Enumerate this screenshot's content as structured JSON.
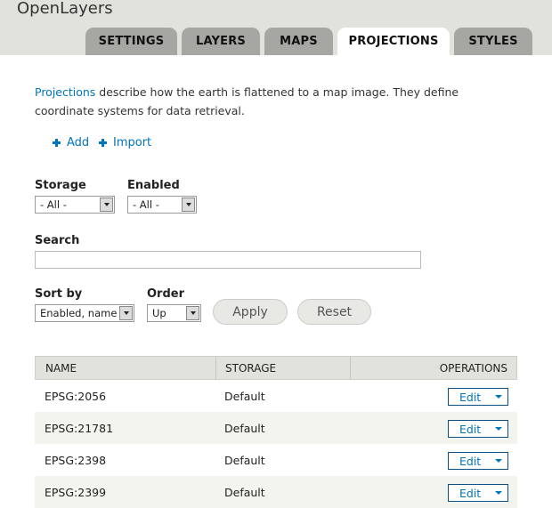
{
  "app": {
    "title": "OpenLayers"
  },
  "tabs": [
    {
      "label": "SETTINGS"
    },
    {
      "label": "LAYERS"
    },
    {
      "label": "MAPS"
    },
    {
      "label": "PROJECTIONS",
      "active": true
    },
    {
      "label": "STYLES"
    }
  ],
  "intro": {
    "link": "Projections",
    "text": " describe how the earth is flattened to a map image. They define coordinate systems for data retrieval."
  },
  "actions": {
    "add": "Add",
    "import": "Import"
  },
  "filters": {
    "storage": {
      "label": "Storage",
      "value": "- All -"
    },
    "enabled": {
      "label": "Enabled",
      "value": "- All -"
    },
    "search": {
      "label": "Search",
      "value": ""
    },
    "sort_by": {
      "label": "Sort by",
      "value": "Enabled, name"
    },
    "order": {
      "label": "Order",
      "value": "Up"
    },
    "apply": "Apply",
    "reset": "Reset"
  },
  "table": {
    "headers": {
      "name": "NAME",
      "storage": "STORAGE",
      "operations": "OPERATIONS"
    },
    "rows": [
      {
        "name": "EPSG:2056",
        "storage": "Default",
        "op": "Edit"
      },
      {
        "name": "EPSG:21781",
        "storage": "Default",
        "op": "Edit"
      },
      {
        "name": "EPSG:2398",
        "storage": "Default",
        "op": "Edit"
      },
      {
        "name": "EPSG:2399",
        "storage": "Default",
        "op": "Edit"
      }
    ]
  },
  "colors": {
    "header_bg": "#e1e2dc",
    "tab_bg": "#a6a7a2",
    "link": "#0074bd",
    "row_alt": "#f3f4ee"
  },
  "icons": {
    "add": "plus-icon",
    "import": "plus-icon",
    "dropdown": "chevron-down-icon"
  }
}
